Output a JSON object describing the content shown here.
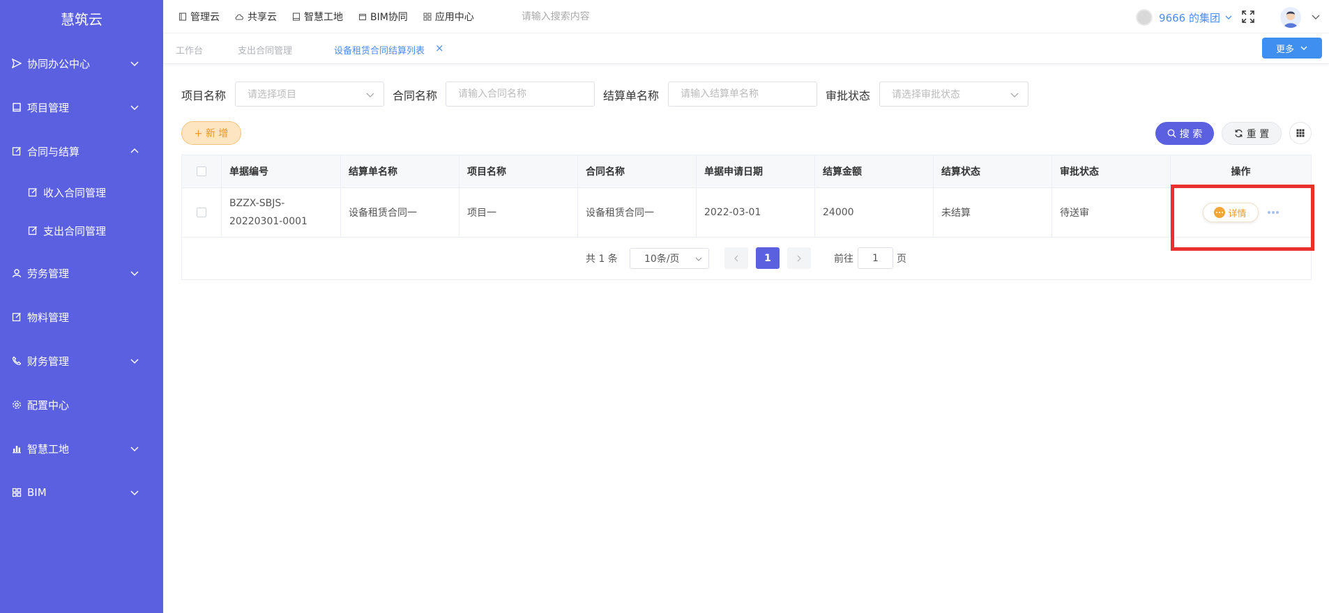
{
  "app": {
    "brand": "慧筑云"
  },
  "sidebar": {
    "items": [
      {
        "label": "协同办公中心",
        "icon": "send-icon",
        "expandable": true
      },
      {
        "label": "项目管理",
        "icon": "book-icon",
        "expandable": true
      },
      {
        "label": "合同与结算",
        "icon": "edit-icon",
        "expandable": true,
        "expanded": true
      },
      {
        "label": "收入合同管理",
        "icon": "edit-icon",
        "sub": true
      },
      {
        "label": "支出合同管理",
        "icon": "edit-icon",
        "sub": true
      },
      {
        "label": "劳务管理",
        "icon": "worker-icon",
        "expandable": true
      },
      {
        "label": "物料管理",
        "icon": "edit-icon",
        "expandable": false
      },
      {
        "label": "财务管理",
        "icon": "phone-icon",
        "expandable": true
      },
      {
        "label": "配置中心",
        "icon": "gear-icon",
        "expandable": false
      },
      {
        "label": "智慧工地",
        "icon": "bar-chart-icon",
        "expandable": true
      },
      {
        "label": "BIM",
        "icon": "grid-icon",
        "expandable": true
      }
    ]
  },
  "topbar": {
    "links": [
      {
        "label": "管理云",
        "icon": "book-icon"
      },
      {
        "label": "共享云",
        "icon": "cloud-icon"
      },
      {
        "label": "智慧工地",
        "icon": "book-icon"
      },
      {
        "label": "BIM协同",
        "icon": "box-icon"
      },
      {
        "label": "应用中心",
        "icon": "grid-icon"
      }
    ],
    "search_placeholder": "请输入搜索内容",
    "org_name": "9666 的集团"
  },
  "tabs": {
    "items": [
      {
        "label": "工作台",
        "active": false
      },
      {
        "label": "支出合同管理",
        "active": false
      },
      {
        "label": "设备租赁合同结算列表",
        "active": true,
        "closable": true
      }
    ],
    "close_glyph": "×",
    "more_label": "更多"
  },
  "filters": {
    "project_label": "项目名称",
    "project_placeholder": "请选择项目",
    "contract_label": "合同名称",
    "contract_placeholder": "请输入合同名称",
    "settle_label": "结算单名称",
    "settle_placeholder": "请输入结算单名称",
    "approval_label": "审批状态",
    "approval_placeholder": "请选择审批状态"
  },
  "actions": {
    "add_label": "+ 新 增",
    "search_label": "搜 索",
    "reset_label": "重 置"
  },
  "table": {
    "columns": [
      "单据编号",
      "结算单名称",
      "项目名称",
      "合同名称",
      "单据申请日期",
      "结算金额",
      "结算状态",
      "审批状态",
      "操作"
    ],
    "rows": [
      {
        "doc_no": "BZZX-SBJS-20220301-0001",
        "settle_name": "设备租赁合同一",
        "project": "项目一",
        "contract": "设备租赁合同一",
        "date": "2022-03-01",
        "amount": "24000",
        "settle_status": "未结算",
        "approval_status": "待送审",
        "detail_label": "详情"
      }
    ]
  },
  "pagination": {
    "total_text": "共 1 条",
    "page_size": "10条/页",
    "current_page": "1",
    "goto_label": "前往",
    "goto_value": "1",
    "page_suffix": "页"
  },
  "colors": {
    "sidebar_bg": "#5a60e0",
    "primary": "#5a60e0",
    "link_blue": "#4e8cf5",
    "warning": "#f3a536",
    "highlight": "#e8302f"
  }
}
